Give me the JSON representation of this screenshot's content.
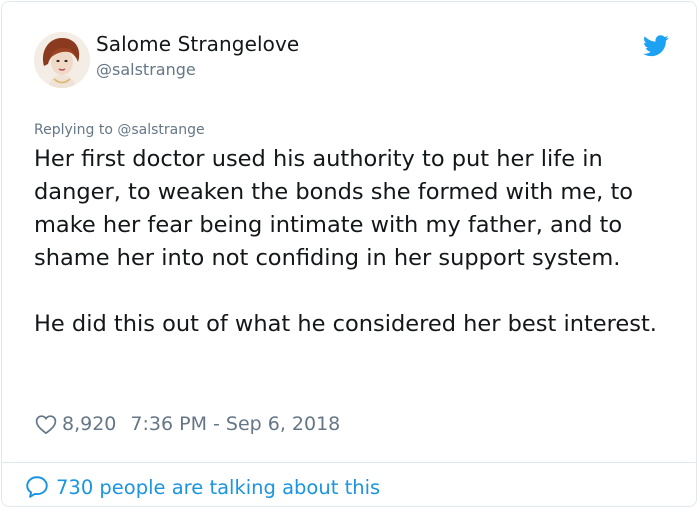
{
  "tweet": {
    "author_name": "Salome Strangelove",
    "author_handle": "@salstrange",
    "replying_to": "Replying to @salstrange",
    "text": "Her first doctor used his authority to put her life in danger, to weaken the bonds she formed with me, to make her fear being intimate with my father, and to shame her into not confiding in her support system.\n\nHe did this out of what he considered her best interest.",
    "likes": "8,920",
    "timestamp": "7:36 PM - Sep 6, 2018",
    "talking": "730 people are talking about this"
  },
  "icons": {
    "like": "heart-icon",
    "platform": "twitter-bird-icon",
    "discussion": "speech-bubble-icon"
  },
  "colors": {
    "brand": "#1da1f2",
    "link": "#1b95e0",
    "secondary_text": "#657786",
    "divider": "#e1e8ed"
  }
}
